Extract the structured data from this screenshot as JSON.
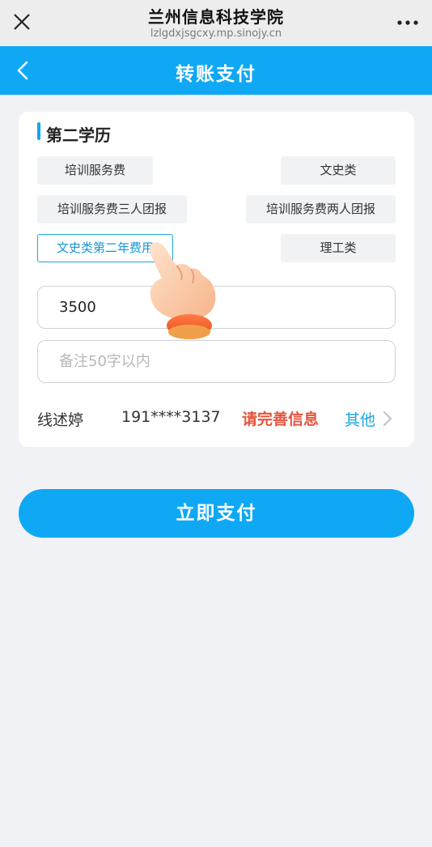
{
  "wechat_bar": {
    "title": "兰州信息科技学院",
    "url": "lzlgdxjsgcxy.mp.sinojy.cn"
  },
  "nav": {
    "title": "转账支付"
  },
  "section": {
    "title": "第二学历"
  },
  "options": [
    {
      "label": "培训服务费",
      "selected": false
    },
    {
      "label": "文史类",
      "selected": false
    },
    {
      "label": "培训服务费三人团报",
      "selected": false
    },
    {
      "label": "培训服务费两人团报",
      "selected": false
    },
    {
      "label": "文史类第二年费用",
      "selected": true
    },
    {
      "label": "理工类",
      "selected": false
    }
  ],
  "amount": {
    "value": "3500"
  },
  "note": {
    "placeholder": "备注50字以内"
  },
  "payer": {
    "name": "线述婷",
    "phone": "191****3137",
    "warning": "请完善信息",
    "other_label": "其他"
  },
  "pay_button": {
    "label": "立即支付"
  },
  "colors": {
    "primary": "#0ea8f5",
    "warning": "#e5533d",
    "selected_chip": "#1aa6e0"
  }
}
